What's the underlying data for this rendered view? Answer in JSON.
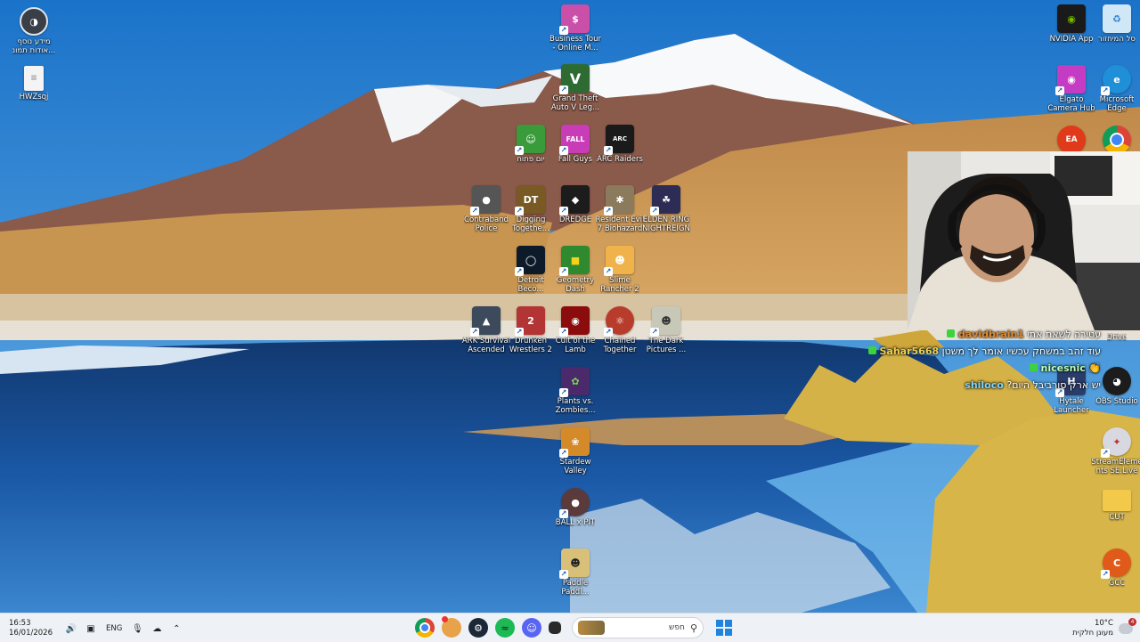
{
  "desktop": {
    "icons_left": [
      {
        "label": "מידע נוסף\nאודות תמונ...",
        "icon": "info-icon"
      },
      {
        "label": "HWZsqj",
        "icon": "file-icon"
      }
    ],
    "icons_center": [
      {
        "label": "Business Tour\n- Online M...",
        "icon": "business-tour-icon",
        "color": "#c94fa8"
      },
      {
        "label": "Grand Theft\nAuto V Leg...",
        "icon": "gta-icon",
        "color": "#2e6b33"
      },
      {
        "label": "יום פתוח",
        "icon": "open-day-icon",
        "color": "#3a9b3a"
      },
      {
        "label": "Fall Guys",
        "icon": "fall-guys-icon",
        "color": "#c83cb8"
      },
      {
        "label": "ARC Raiders",
        "icon": "arc-raiders-icon",
        "color": "#1a1a1a"
      },
      {
        "label": "Contraband\nPolice",
        "icon": "contraband-police-icon",
        "color": "#555"
      },
      {
        "label": "Digging\nTogethe...",
        "icon": "digging-together-icon",
        "color": "#7a5a24"
      },
      {
        "label": "DREDGE",
        "icon": "dredge-icon",
        "color": "#1c1c1c"
      },
      {
        "label": "Resident Evil\n7 Biohazard",
        "icon": "resident-evil-icon",
        "color": "#8c7a5c"
      },
      {
        "label": "ELDEN RING\nNIGHTREIGN",
        "icon": "elden-ring-icon",
        "color": "#2c2c55"
      },
      {
        "label": "Detroit\nBeco...",
        "icon": "detroit-icon",
        "color": "#0d1a2a"
      },
      {
        "label": "Geometry\nDash",
        "icon": "geometry-dash-icon",
        "color": "#2f8a2f"
      },
      {
        "label": "Slime\nRancher 2",
        "icon": "slime-rancher-icon",
        "color": "#f0b34b"
      },
      {
        "label": "ARK Survival\nAscended",
        "icon": "ark-icon",
        "color": "#3c4a5c"
      },
      {
        "label": "Drunken\nWrestlers 2",
        "icon": "drunken-wrestlers-icon",
        "color": "#b23434"
      },
      {
        "label": "Cult of the\nLamb",
        "icon": "cult-of-the-lamb-icon",
        "color": "#8a0c0c"
      },
      {
        "label": "Chained\nTogether",
        "icon": "chained-together-icon",
        "color": "#b83c2c"
      },
      {
        "label": "The Dark\nPictures ...",
        "icon": "dark-pictures-icon",
        "color": "#c8c8b8"
      },
      {
        "label": "Plants vs.\nZombies...",
        "icon": "plants-vs-zombies-icon",
        "color": "#4a2a6a"
      },
      {
        "label": "Stardew\nValley",
        "icon": "stardew-valley-icon",
        "color": "#d58a2a"
      },
      {
        "label": "BALL x PIT",
        "icon": "ball-x-pit-icon",
        "color": "#5a3a3a"
      },
      {
        "label": "Paddle\nPaddl...",
        "icon": "paddle-icon",
        "color": "#d8c078"
      }
    ],
    "icons_right": [
      {
        "label": "NVIDIA App",
        "icon": "nvidia-icon",
        "color": "#1a1a1a"
      },
      {
        "label": "סל המיחזור",
        "icon": "recycle-bin-icon",
        "color": "#cfe7f7"
      },
      {
        "label": "Elgato\nCamera Hub",
        "icon": "elgato-icon",
        "color": "#c43cc4"
      },
      {
        "label": "Microsoft\nEdge",
        "icon": "edge-icon",
        "color": "#1f8fd8"
      },
      {
        "label": "Drive",
        "icon": "drive-icon",
        "color": "#d8d8d8"
      },
      {
        "label": "Hytale\nLauncher",
        "icon": "hytale-icon",
        "color": "#2a3c6a"
      },
      {
        "label": "OBS Studio",
        "icon": "obs-icon",
        "color": "#1c1c1c"
      },
      {
        "label": "StreamEleme\nnts SE.Live",
        "icon": "streamelements-icon",
        "color": "#d8d8e0"
      },
      {
        "label": "CUT",
        "icon": "folder-icon",
        "color": "#f3c94b"
      },
      {
        "label": "GCC",
        "icon": "gcc-icon",
        "color": "#e05a1a"
      }
    ]
  },
  "chat": [
    {
      "name": "davidbrain1",
      "text": "עטירה לשאת אתי"
    },
    {
      "name": "Sahar5668",
      "text": "עוד זהב במשחק עכשיו אומר לך משטן"
    },
    {
      "name": "nicesnic",
      "text": "👏"
    },
    {
      "name": "shiloco",
      "text": "יש ארק סורביבל היום?"
    }
  ],
  "taskbar": {
    "clock_time": "16:53",
    "clock_date": "16/01/2026",
    "lang": "ENG",
    "search_placeholder": "חפש",
    "weather_temp": "10°C",
    "weather_desc": "מעונן חלקית",
    "notif_count": "4",
    "pinned": [
      "chrome-icon",
      "app-icon",
      "steam-icon",
      "spotify-icon",
      "discord-icon",
      "file-explorer-icon"
    ]
  }
}
